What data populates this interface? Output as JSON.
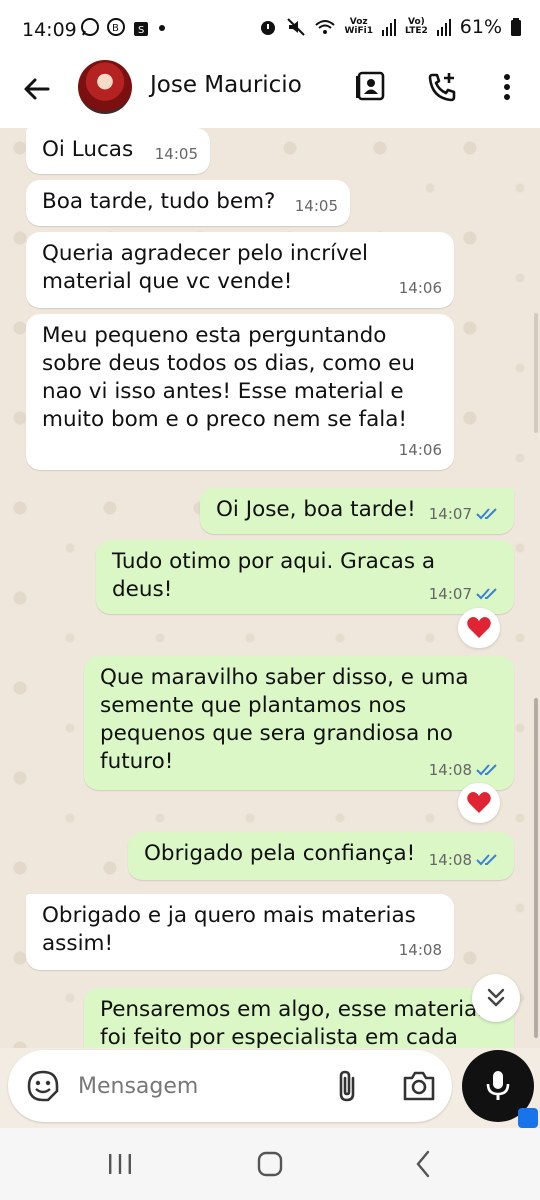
{
  "status_bar": {
    "time": "14:09",
    "voz_wifi": [
      "Voz",
      "WiFi1"
    ],
    "volte": [
      "Vo)",
      "LTE2"
    ],
    "battery": "61%"
  },
  "header": {
    "contact_name": "Jose Mauricio"
  },
  "messages": [
    {
      "dir": "in",
      "text": "Oi Lucas",
      "time": "14:05"
    },
    {
      "dir": "in",
      "text": "Boa tarde, tudo bem?",
      "time": "14:05"
    },
    {
      "dir": "in",
      "text": "Queria agradecer pelo incrível material que vc vende!",
      "time": "14:06"
    },
    {
      "dir": "in",
      "text": "Meu pequeno esta perguntando sobre deus todos os dias, como eu nao vi isso antes! Esse material e muito bom e o preco nem se fala!",
      "time": "14:06"
    },
    {
      "dir": "out",
      "text": "Oi Jose, boa tarde!",
      "time": "14:07",
      "status": "read"
    },
    {
      "dir": "out",
      "text": "Tudo otimo por aqui. Gracas a deus!",
      "time": "14:07",
      "status": "read",
      "reaction": "heart"
    },
    {
      "dir": "out",
      "text": "Que maravilho saber disso, e uma semente que plantamos nos pequenos que sera grandiosa no futuro!",
      "time": "14:08",
      "status": "read",
      "reaction": "heart"
    },
    {
      "dir": "out",
      "text": "Obrigado pela confiança!",
      "time": "14:08",
      "status": "read"
    },
    {
      "dir": "in",
      "text": "Obrigado e ja quero mais materias assim!",
      "time": "14:08"
    },
    {
      "dir": "out",
      "text": "Pensaremos em algo, esse material foi feito por especialista em cada",
      "partial": true
    }
  ],
  "composer": {
    "placeholder": "Mensagem"
  },
  "colors": {
    "incoming_bubble": "#ffffff",
    "outgoing_bubble": "#dbf7c6",
    "read_ticks": "#3b82d6",
    "reaction_heart": "#e02433",
    "mic_button": "#111111"
  },
  "icons": [
    "back-arrow-icon",
    "contact-card-icon",
    "add-call-icon",
    "more-vert-icon",
    "emoji-icon",
    "attach-icon",
    "camera-icon",
    "mic-icon",
    "scroll-down-icon"
  ]
}
